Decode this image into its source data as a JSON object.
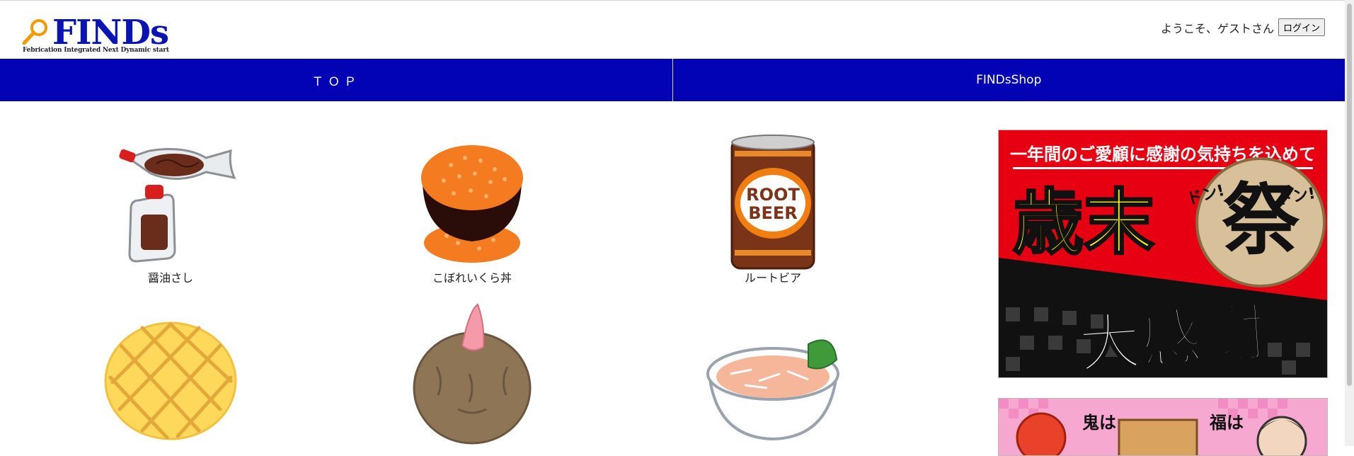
{
  "header": {
    "logo_text": "FINDs",
    "logo_tagline": "Febrication Integrated Next Dynamic start",
    "welcome_text": "ようこそ、ゲストさん",
    "login_label": "ログイン"
  },
  "nav": {
    "items": [
      {
        "label": "ＴＯＰ"
      },
      {
        "label": "FINDsShop"
      }
    ]
  },
  "products": [
    {
      "label": "醤油さし",
      "icon": "soy-sauce-icon"
    },
    {
      "label": "こぼれいくら丼",
      "icon": "ikura-don-icon"
    },
    {
      "label": "ルートビア",
      "icon": "root-beer-icon"
    },
    {
      "label": "",
      "icon": "melon-pan-icon"
    },
    {
      "label": "",
      "icon": "sata-andagi-icon"
    },
    {
      "label": "",
      "icon": "rice-bowl-icon"
    }
  ],
  "root_beer_can_text": [
    "ROOT",
    "BEER"
  ],
  "banners": {
    "year_end": {
      "top_text": "一年間のご愛顧に感謝の気持ちを込めて",
      "main_text": "歳末",
      "drum_text": "祭",
      "don_left": "ドン!",
      "don_right": "ドン!",
      "bottom_text": "大感謝"
    },
    "setsubun": {
      "text_left": "鬼は",
      "text_right": "福は"
    }
  },
  "colors": {
    "nav_bg": "#0303b6",
    "logo_blue": "#0a14b4",
    "banner_red": "#e60012",
    "banner_yellow": "#fff200"
  }
}
